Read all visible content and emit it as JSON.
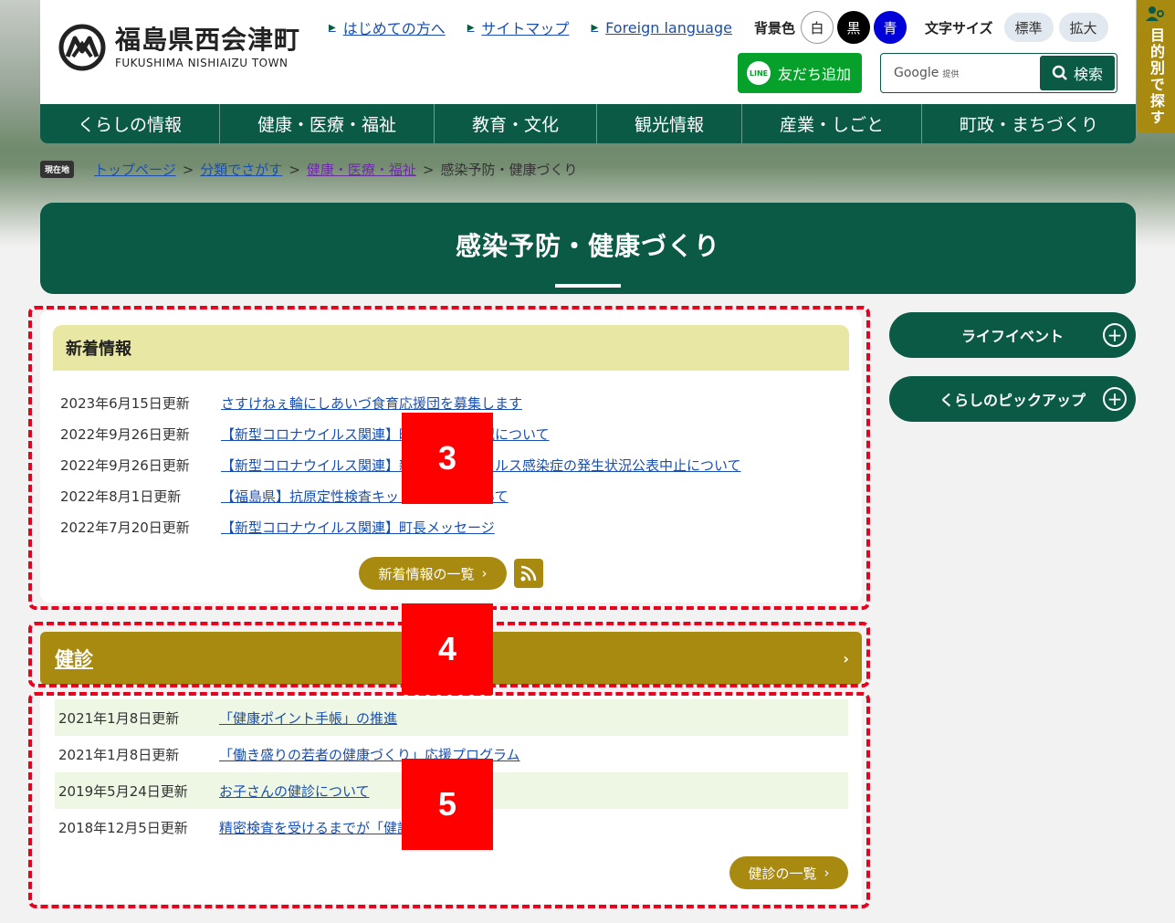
{
  "site": {
    "name_jp": "福島県西会津町",
    "name_en": "FUKUSHIMA NISHIAIZU TOWN"
  },
  "util_links": [
    {
      "label": "はじめての方へ"
    },
    {
      "label": "サイトマップ"
    },
    {
      "label": "Foreign language"
    }
  ],
  "bgcolor": {
    "label": "背景色",
    "white": "白",
    "black": "黒",
    "blue": "青"
  },
  "fontsize": {
    "label": "文字サイズ",
    "standard": "標準",
    "large": "拡大"
  },
  "line_button": {
    "icon_text": "LINE",
    "label": "友だち追加"
  },
  "search": {
    "google": "Google",
    "provided": "提供",
    "button": "検索"
  },
  "side_tab": {
    "label": "目的別で探す"
  },
  "gnav": [
    {
      "label": "くらしの情報"
    },
    {
      "label": "健康・医療・福祉"
    },
    {
      "label": "教育・文化"
    },
    {
      "label": "観光情報"
    },
    {
      "label": "産業・しごと"
    },
    {
      "label": "町政・まちづくり"
    }
  ],
  "breadcrumb": {
    "here": "現在地",
    "items": [
      "トップページ",
      "分類でさがす",
      "健康・医療・福祉"
    ],
    "current": "感染予防・健康づくり",
    "sep": ">"
  },
  "page_title": "感染予防・健康づくり",
  "news": {
    "heading": "新着情報",
    "items": [
      {
        "date": "2023年6月15日更新",
        "title": "さすけねぇ輪にしあいづ食育応援団を募集します"
      },
      {
        "date": "2022年9月26日更新",
        "title": "【新型コロナウイルス関連】町内の発生状況について"
      },
      {
        "date": "2022年9月26日更新",
        "title": "【新型コロナウイルス関連】新型コロナウイルス感染症の発生状況公表中止について"
      },
      {
        "date": "2022年8月1日更新",
        "title": "【福島県】抗原定性検査キットの配布について"
      },
      {
        "date": "2022年7月20日更新",
        "title": "【新型コロナウイルス関連】町長メッセージ"
      }
    ],
    "more": "新着情報の一覧"
  },
  "kenshin": {
    "heading": "健診",
    "items": [
      {
        "date": "2021年1月8日更新",
        "title": "「健康ポイント手帳」の推進"
      },
      {
        "date": "2021年1月8日更新",
        "title": "「働き盛りの若者の健康づくり」応援プログラム"
      },
      {
        "date": "2019年5月24日更新",
        "title": "お子さんの健診について"
      },
      {
        "date": "2018年12月5日更新",
        "title": "精密検査を受けるまでが「健診」です"
      }
    ],
    "more": "健診の一覧"
  },
  "right_menu": [
    {
      "label": "ライフイベント"
    },
    {
      "label": "くらしのピックアップ"
    }
  ],
  "markers": [
    "3",
    "4",
    "5"
  ],
  "colors": {
    "brand_green": "#0b5a46",
    "gold": "#a98a10",
    "news_head": "#e8e7a4",
    "highlight_red": "#e8001c"
  }
}
